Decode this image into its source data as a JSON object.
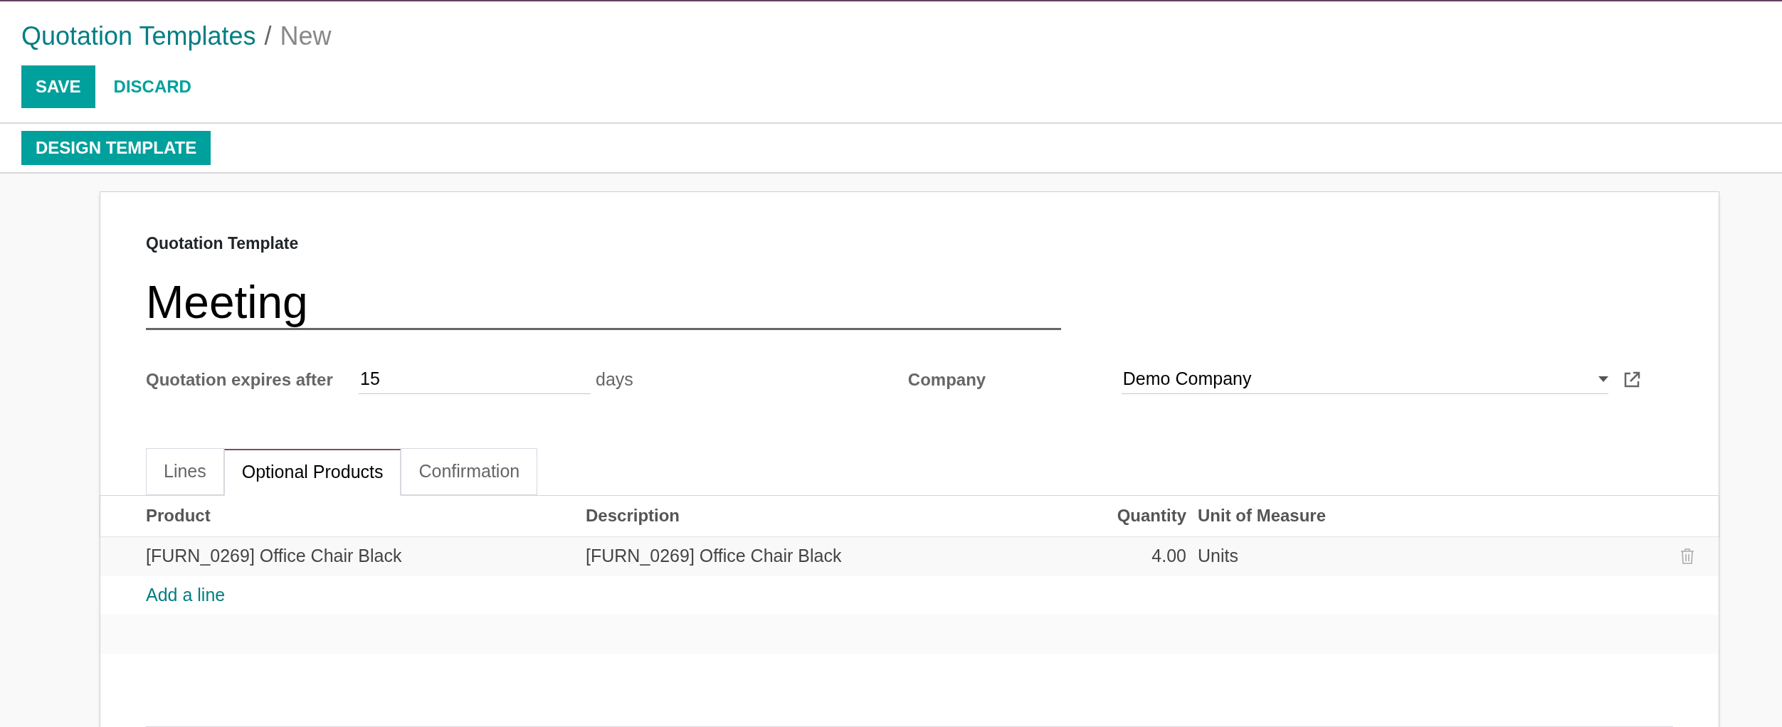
{
  "breadcrumb": [
    {
      "label": "Quotation Templates",
      "kind": "link"
    },
    {
      "label": "/",
      "kind": "separator"
    },
    {
      "label": "New",
      "kind": "current"
    }
  ],
  "buttons": [
    {
      "label": "SAVE",
      "kind": "primary"
    },
    {
      "label": "DISCARD",
      "kind": "link"
    }
  ],
  "statusbar_buttons": [
    {
      "label": "DESIGN TEMPLATE",
      "kind": "primary"
    }
  ],
  "form": {
    "name_label": "Quotation Template",
    "name_value": "Meeting",
    "expires_label": "Quotation expires after",
    "expires_value": "15",
    "expires_unit": "days",
    "company_label": "Company",
    "company_value": "Demo Company"
  },
  "tabs": [
    {
      "label": "Lines",
      "selected": false
    },
    {
      "label": "Optional Products",
      "selected": true
    },
    {
      "label": "Confirmation",
      "selected": false
    }
  ],
  "table": {
    "columns": [
      "Product",
      "Description",
      "Quantity",
      "Unit of Measure"
    ],
    "rows": [
      {
        "cells": [
          "[FURN_0269] Office Chair Black",
          "[FURN_0269] Office Chair Black",
          "4.00",
          "Units"
        ]
      }
    ],
    "add_line": "Add a line"
  }
}
